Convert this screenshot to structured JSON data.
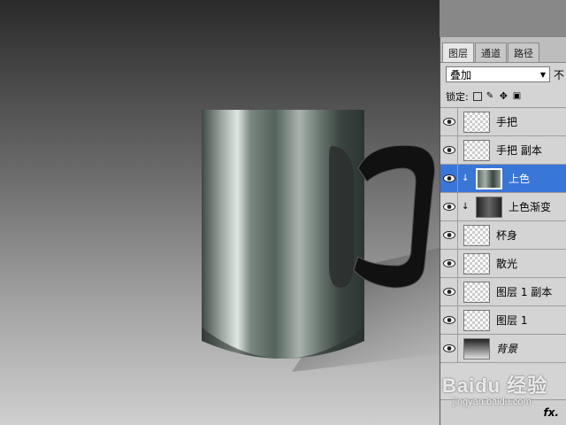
{
  "layers_panel": {
    "tabs": [
      {
        "label": "图层",
        "active": true
      },
      {
        "label": "通道",
        "active": false
      },
      {
        "label": "路径",
        "active": false
      }
    ],
    "blend_mode": "叠加",
    "opacity_label": "不",
    "lock_label": "锁定:",
    "layers": [
      {
        "name": "手把",
        "thumb": "transparent",
        "selected": false,
        "clipped": false
      },
      {
        "name": "手把 副本",
        "thumb": "transparent",
        "selected": false,
        "clipped": false
      },
      {
        "name": "上色",
        "thumb": "color",
        "selected": true,
        "clipped": true
      },
      {
        "name": "上色渐变",
        "thumb": "dark",
        "selected": false,
        "clipped": true
      },
      {
        "name": "杯身",
        "thumb": "transparent",
        "selected": false,
        "clipped": false
      },
      {
        "name": "散光",
        "thumb": "transparent",
        "selected": false,
        "clipped": false
      },
      {
        "name": "图层 1 副本",
        "thumb": "transparent",
        "selected": false,
        "clipped": false
      },
      {
        "name": "图层 1",
        "thumb": "transparent",
        "selected": false,
        "clipped": false
      },
      {
        "name": "背景",
        "thumb": "bg",
        "selected": false,
        "clipped": false,
        "italic": true
      }
    ],
    "fx_label": "fx."
  },
  "watermark": {
    "line1": "Baidu 经验",
    "line2": "jingyan.baidu.com"
  },
  "colors": {
    "selected": "#3876d8",
    "panel_bg": "#d4d4d4"
  }
}
